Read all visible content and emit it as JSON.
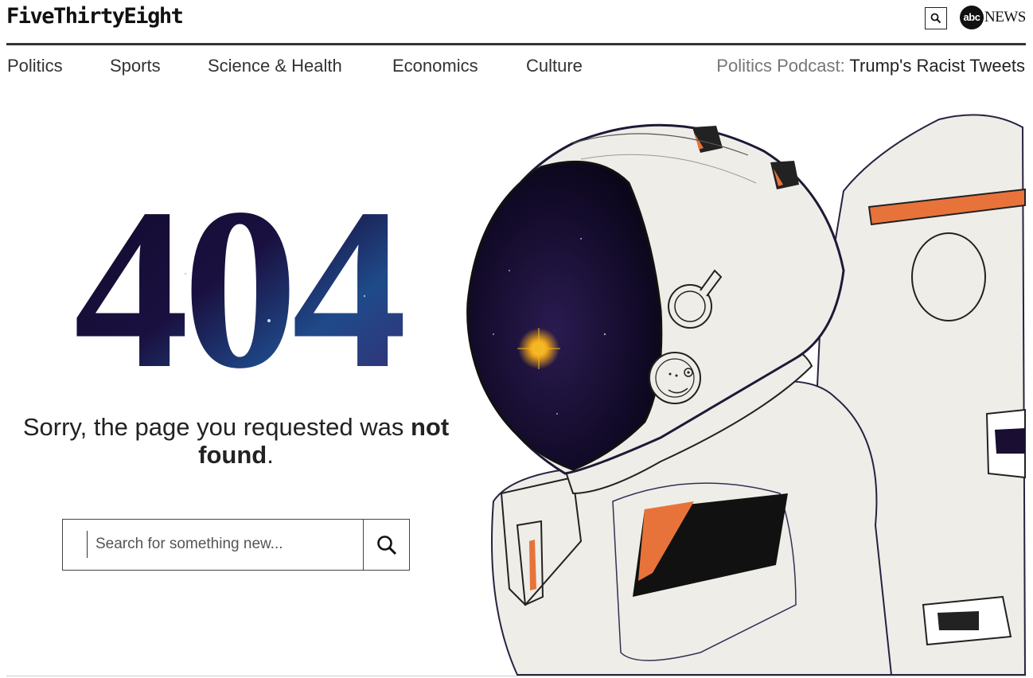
{
  "header": {
    "logo": "FiveThirtyEight",
    "search_icon": "search-icon",
    "partner_disc": "abc",
    "partner_word": "NEWS"
  },
  "nav": {
    "items": [
      {
        "label": "Politics"
      },
      {
        "label": "Sports"
      },
      {
        "label": "Science & Health"
      },
      {
        "label": "Economics"
      },
      {
        "label": "Culture"
      }
    ],
    "promo_label": "Politics Podcast:",
    "promo_title": "Trump's Racist Tweets"
  },
  "error": {
    "code": "404",
    "message_prefix": "Sorry, the page you requested was ",
    "message_bold": "not found",
    "message_suffix": "."
  },
  "search": {
    "placeholder": "Search for something new...",
    "button_icon": "search-icon"
  },
  "colors": {
    "accent_orange": "#e8733a",
    "space_dark": "#1a0f33",
    "space_blue": "#1f4a8a",
    "suit": "#eeede8"
  }
}
